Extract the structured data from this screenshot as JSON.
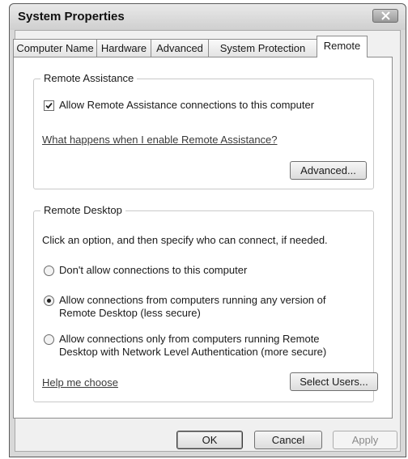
{
  "window": {
    "title": "System Properties"
  },
  "tabs": [
    {
      "label": "Computer Name"
    },
    {
      "label": "Hardware"
    },
    {
      "label": "Advanced"
    },
    {
      "label": "System Protection"
    },
    {
      "label": "Remote",
      "active": true
    }
  ],
  "remote_assistance": {
    "legend": "Remote Assistance",
    "allow_checkbox_label": "Allow Remote Assistance connections to this computer",
    "allow_checked": true,
    "help_link": "What happens when I enable Remote Assistance?",
    "advanced_button": "Advanced..."
  },
  "remote_desktop": {
    "legend": "Remote Desktop",
    "instructions": "Click an option, and then specify who can connect, if needed.",
    "option_none": "Don't allow connections to this computer",
    "option_any_line1": "Allow connections from computers running any version of",
    "option_any_line2": "Remote Desktop (less secure)",
    "option_nla_line1": "Allow connections only from computers running Remote",
    "option_nla_line2": "Desktop with Network Level Authentication (more secure)",
    "selected_option": "any",
    "help_link": "Help me choose",
    "select_users_button": "Select Users..."
  },
  "buttons": {
    "ok": "OK",
    "cancel": "Cancel",
    "apply": "Apply"
  },
  "icons": {
    "close": "close-icon",
    "check": "checkmark-icon"
  }
}
